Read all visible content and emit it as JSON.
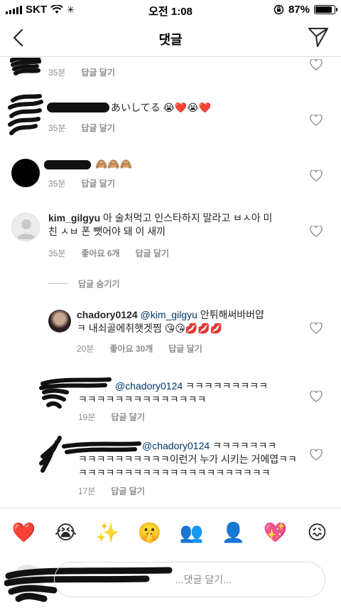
{
  "status": {
    "carrier": "SKT",
    "time": "오전 1:08",
    "battery_text": "87%",
    "battery_level": 0.87
  },
  "header": {
    "title": "댓글"
  },
  "comments": [
    {
      "text": "",
      "time": "35분",
      "reply": "답글 달기"
    },
    {
      "text": "あいしてる 😭❤️😭❤️",
      "time": "35분",
      "reply": "답글 달기"
    },
    {
      "text": "🙈🙈🙈",
      "time": "35분",
      "reply": "답글 달기"
    },
    {
      "username": "kim_gilgyu",
      "text_line1": "아 술처먹고 인스타하지 말라고 ㅂㅅ아 미",
      "text_line2": "친 ㅅㅂ 폰 뺏어야 돼 이 새끼",
      "time": "35분",
      "likes": "좋아요 6개",
      "reply": "답글 달기"
    }
  ],
  "hide_replies_label": "답글 숨기기",
  "replies": [
    {
      "username": "chadory0124",
      "mention": "@kim_gilgyu",
      "text_line1": "안튀해써바버얍",
      "text_line2": "ㅋ 내쇠골에취햇겟찜 😘😘💋💋💋",
      "time": "20분",
      "likes": "좋아요 30개",
      "reply": "답글 달기"
    },
    {
      "mention": "@chadory0124",
      "text_line1": "ㅋㅋㅋㅋㅋㅋㅋㅋㅋ",
      "text_line2": "ㅋㅋㅋㅋㅋㅋㅋㅋㅋㅋㅋㅋㅋㅋ",
      "time": "19분",
      "reply": "답글 달기"
    },
    {
      "mention": "@chadory0124",
      "text_line1": "ㅋㅋㅋㅋㅋㅋㅋ",
      "text_line2": "ㅋㅋㅋㅋㅋㅋㅋㅋㅋㅋ이런거 누가 시키는 거에엽ㅋㅋ",
      "text_line3": "ㅋㅋㅋㅋㅋㅋㅋㅋㅋㅋㅋㅋㅋㅋㅋㅋㅋㅋㅋㅋㅋ",
      "time": "17분",
      "reply": "답글 달기"
    }
  ],
  "emojis": [
    "❤️",
    "😭",
    "✨",
    "🤫",
    "👥",
    "👤",
    "💖",
    "😖"
  ],
  "input": {
    "placeholder": "...댓글 달기..."
  }
}
